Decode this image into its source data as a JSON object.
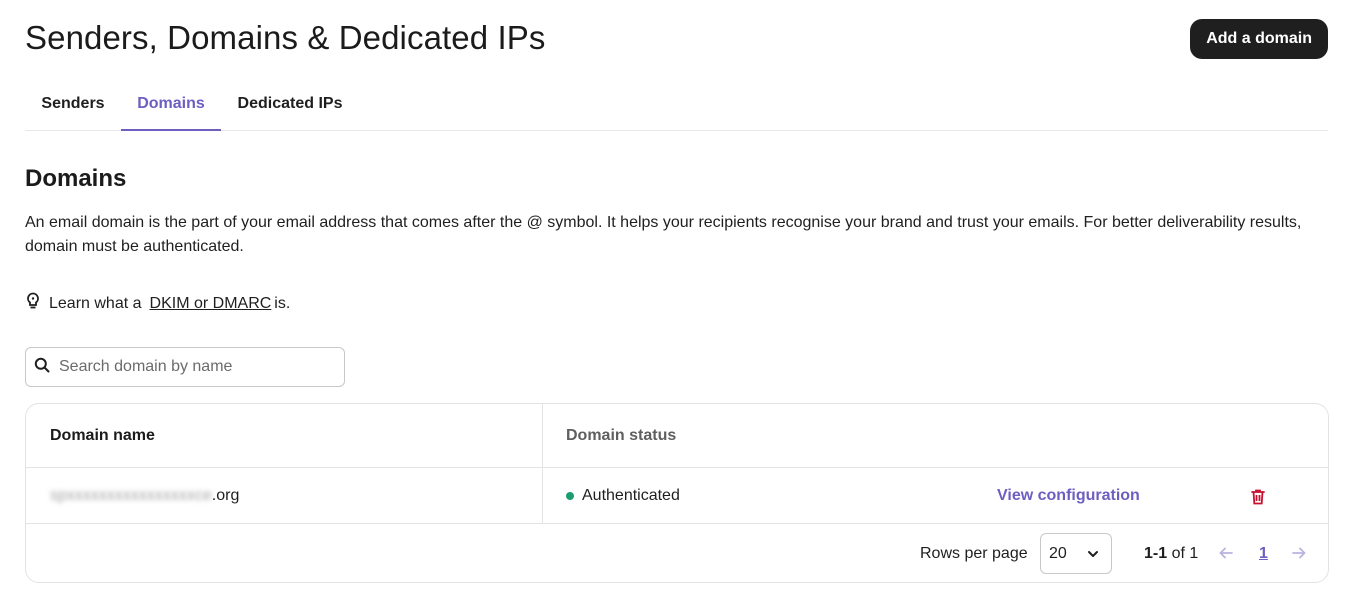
{
  "header": {
    "title": "Senders, Domains & Dedicated IPs",
    "add_button_label": "Add a domain"
  },
  "tabs": [
    {
      "label": "Senders",
      "active": false
    },
    {
      "label": "Domains",
      "active": true
    },
    {
      "label": "Dedicated IPs",
      "active": false
    }
  ],
  "section": {
    "title": "Domains",
    "description": "An email domain is the part of your email address that comes after the @ symbol. It helps your recipients recognise your brand and trust your emails. For better deliverability results, domain must be authenticated.",
    "learn_prefix": "Learn what a",
    "learn_link": "DKIM or DMARC",
    "learn_suffix": "is.",
    "learn_icon": "lightbulb-icon"
  },
  "search": {
    "placeholder": "Search domain by name",
    "value": "",
    "icon": "search-icon"
  },
  "table": {
    "columns": [
      "Domain name",
      "Domain status"
    ],
    "rows": [
      {
        "domain_blurred": "spxxxxxxxxxxxxxxxxce",
        "domain_suffix": ".org",
        "status": "Authenticated",
        "status_color": "#1a9e6e",
        "action_label": "View configuration",
        "delete_icon": "trash-icon"
      }
    ]
  },
  "pagination": {
    "rows_per_page_label": "Rows per page",
    "rows_per_page": "20",
    "range_bold": "1-1",
    "range_rest": " of 1",
    "current_page": "1"
  },
  "colors": {
    "accent": "#6d5fc0",
    "primary_button": "#1f1f1f",
    "danger": "#c8102e",
    "success": "#1a9e6e"
  }
}
